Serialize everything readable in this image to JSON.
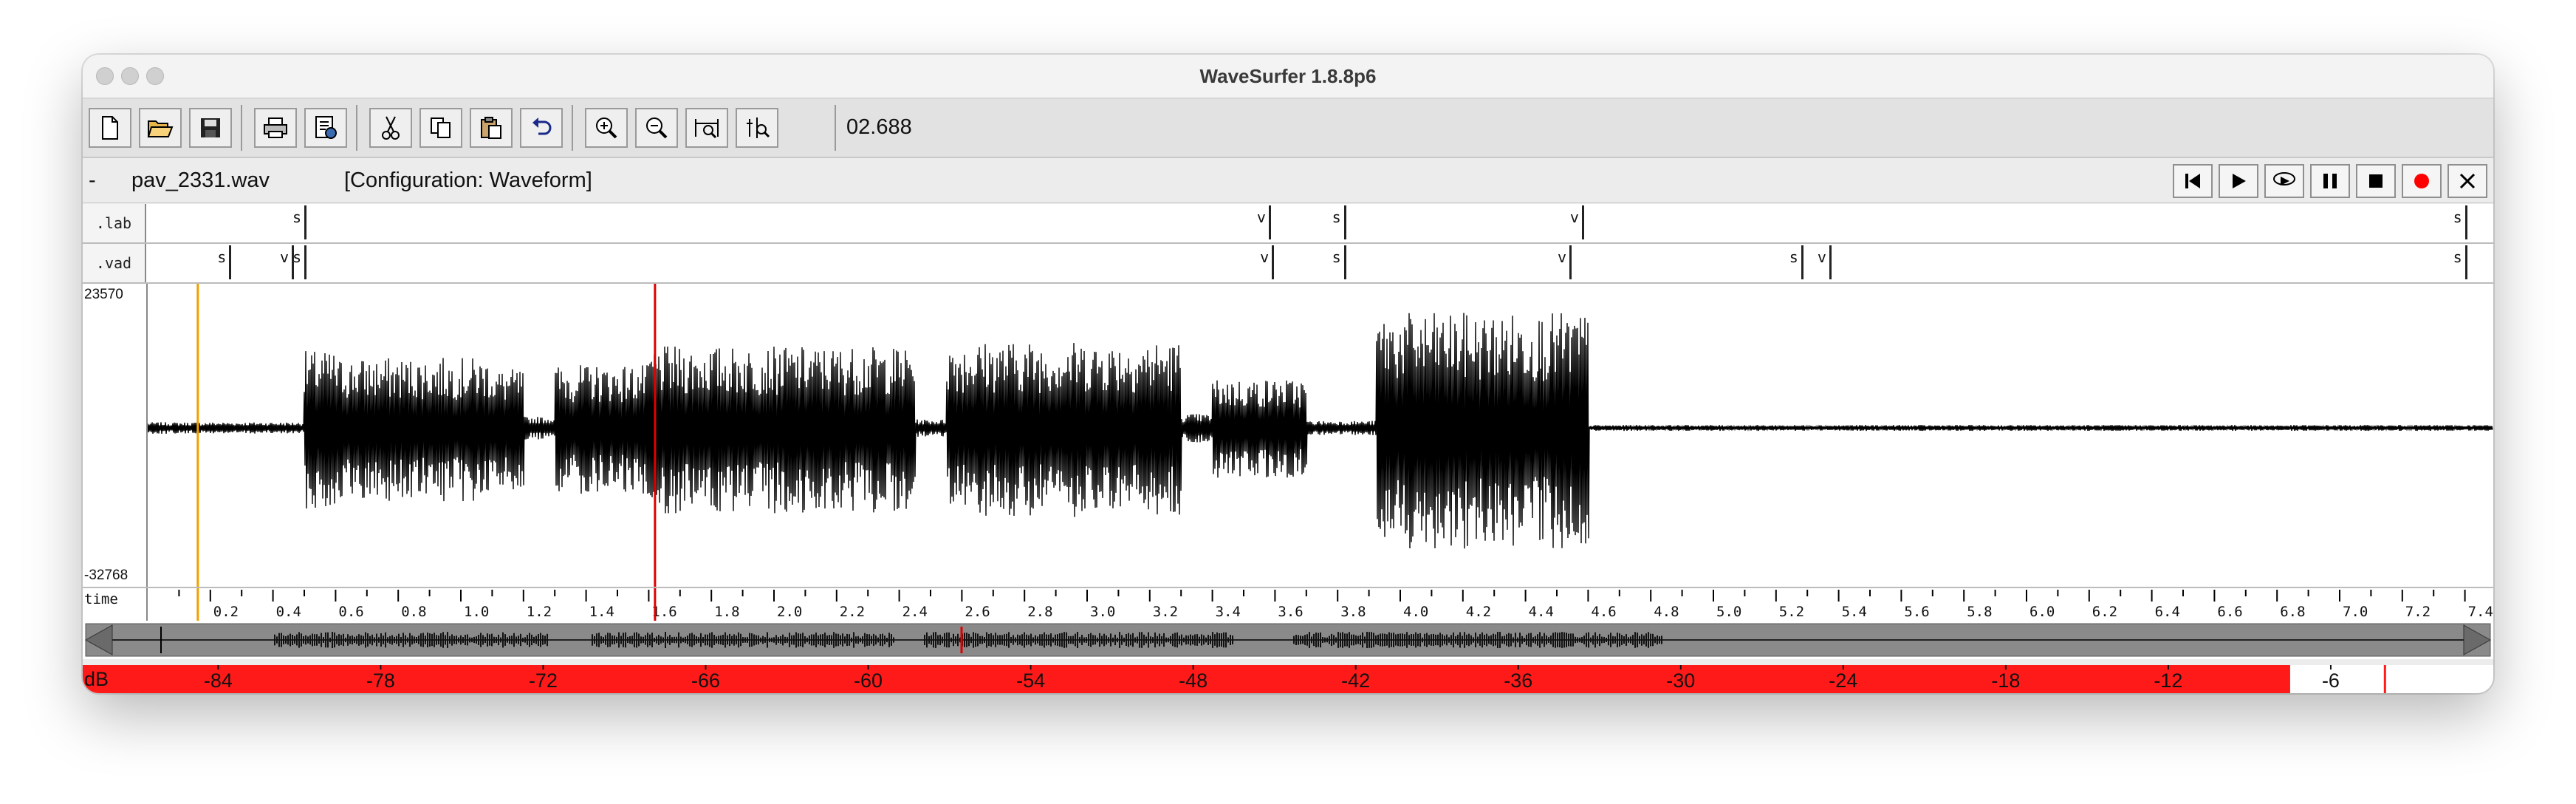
{
  "window": {
    "title": "WaveSurfer 1.8.8p6"
  },
  "toolbar": {
    "icons": [
      "new-file-icon",
      "open-folder-icon",
      "save-icon",
      "print-icon",
      "properties-icon",
      "cut-icon",
      "copy-icon",
      "paste-icon",
      "undo-icon",
      "zoom-in-icon",
      "zoom-out-icon",
      "zoom-fit-icon",
      "zoom-selection-icon"
    ],
    "time_readout": "02.688"
  },
  "sound": {
    "dash": "-",
    "filename": "pav_2331.wav",
    "configuration": "[Configuration: Waveform]"
  },
  "playback": {
    "icons": [
      "skip-to-start-icon",
      "play-icon",
      "play-loop-icon",
      "pause-icon",
      "stop-icon",
      "record-icon",
      "close-icon"
    ],
    "record_color": "#ff0000"
  },
  "lab_track": {
    "label": ".lab",
    "marks": [
      {
        "label": "s",
        "time": 0.5
      },
      {
        "label": "v",
        "time": 3.58
      },
      {
        "label": "s",
        "time": 3.82
      },
      {
        "label": "v",
        "time": 4.58
      },
      {
        "label": "s",
        "time": 7.4
      }
    ]
  },
  "vad_track": {
    "label": ".vad",
    "marks": [
      {
        "label": "s",
        "time": 0.26
      },
      {
        "label": "v",
        "time": 0.46
      },
      {
        "label": "s",
        "time": 0.5
      },
      {
        "label": "v",
        "time": 3.59
      },
      {
        "label": "s",
        "time": 3.82
      },
      {
        "label": "v",
        "time": 4.54
      },
      {
        "label": "s",
        "time": 5.28
      },
      {
        "label": "v",
        "time": 5.37
      },
      {
        "label": "s",
        "time": 7.4
      }
    ]
  },
  "waveform": {
    "max_label": "23570",
    "min_label": "-32768",
    "cursor_time": 1.62,
    "selection_time": 0.16,
    "cursor_color": "#e00000",
    "selection_color": "#f0a000"
  },
  "time_axis": {
    "label": "time",
    "tick_labels": [
      "0.2",
      "0.4",
      "0.6",
      "0.8",
      "1.0",
      "1.2",
      "1.4",
      "1.6",
      "1.8",
      "2.0",
      "2.2",
      "2.4",
      "2.6",
      "2.8",
      "3.0",
      "3.2",
      "3.4",
      "3.6",
      "3.8",
      "4.0",
      "4.2",
      "4.4",
      "4.6",
      "4.8",
      "5.0",
      "5.2",
      "5.4",
      "5.6",
      "5.8",
      "6.0",
      "6.2",
      "6.4",
      "6.6",
      "6.8",
      "7.0",
      "7.2",
      "7.4"
    ]
  },
  "vu_meter": {
    "unit": "dB",
    "scale_labels": [
      "-84",
      "-78",
      "-72",
      "-66",
      "-60",
      "-54",
      "-48",
      "-42",
      "-36",
      "-30",
      "-24",
      "-18",
      "-12",
      "-6"
    ],
    "level_db": -7.5,
    "color": "#ff1a1a"
  }
}
